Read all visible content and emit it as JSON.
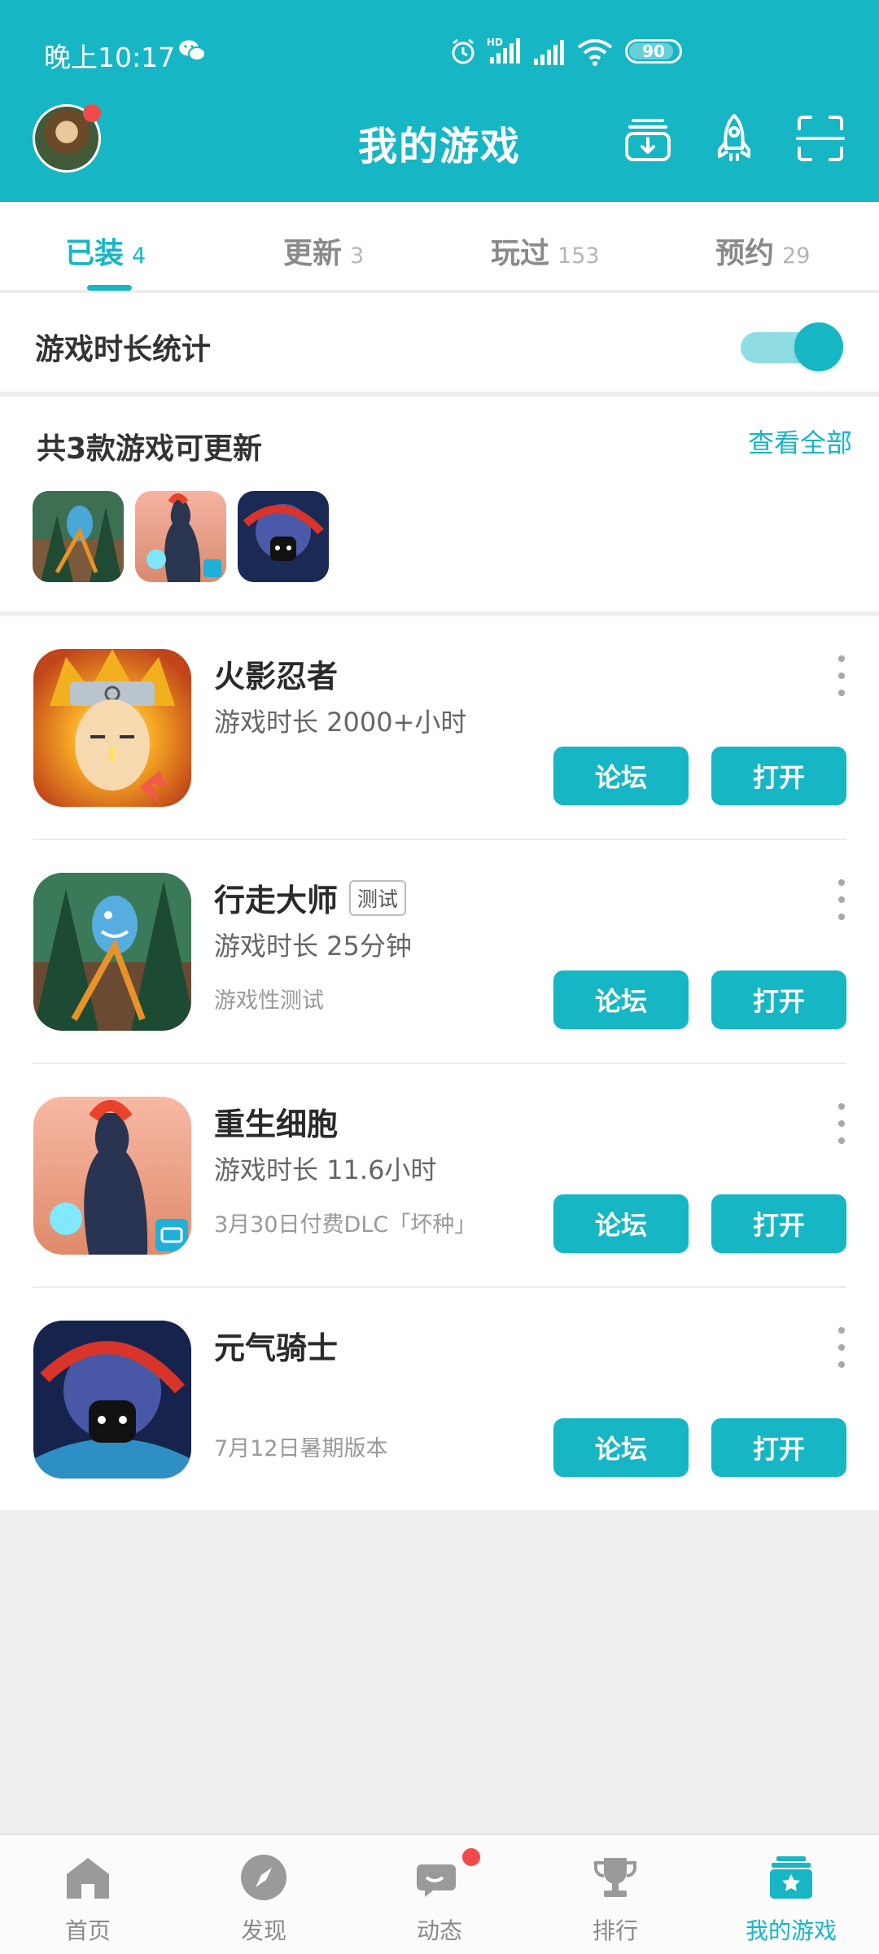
{
  "status_bar": {
    "time": "晚上10:17",
    "battery": "90",
    "battery_level": 0.9
  },
  "header": {
    "title": "我的游戏"
  },
  "tabs": [
    {
      "label": "已装",
      "count": "4"
    },
    {
      "label": "更新",
      "count": "3"
    },
    {
      "label": "玩过",
      "count": "153"
    },
    {
      "label": "预约",
      "count": "29"
    }
  ],
  "stats": {
    "label": "游戏时长统计",
    "enabled": true
  },
  "updates": {
    "title": "共3款游戏可更新",
    "view_all": "查看全部"
  },
  "games": [
    {
      "name": "火影忍者",
      "tag": "",
      "playtime": "游戏时长 2000+小时",
      "sub": "",
      "forum_label": "论坛",
      "open_label": "打开"
    },
    {
      "name": "行走大师",
      "tag": "测试",
      "playtime": "游戏时长 25分钟",
      "sub": "游戏性测试",
      "forum_label": "论坛",
      "open_label": "打开"
    },
    {
      "name": "重生细胞",
      "tag": "",
      "playtime": "游戏时长 11.6小时",
      "sub": "3月30日付费DLC「坏种」",
      "forum_label": "论坛",
      "open_label": "打开"
    },
    {
      "name": "元气骑士",
      "tag": "",
      "playtime": "",
      "sub": "7月12日暑期版本",
      "forum_label": "论坛",
      "open_label": "打开"
    }
  ],
  "bottom_nav": [
    {
      "label": "首页",
      "icon": "home-icon"
    },
    {
      "label": "发现",
      "icon": "compass-icon"
    },
    {
      "label": "动态",
      "icon": "chat-icon"
    },
    {
      "label": "排行",
      "icon": "trophy-icon"
    },
    {
      "label": "我的游戏",
      "icon": "my-games-icon"
    }
  ],
  "colors": {
    "accent": "#17b6c4",
    "badge": "#f24a4a"
  }
}
